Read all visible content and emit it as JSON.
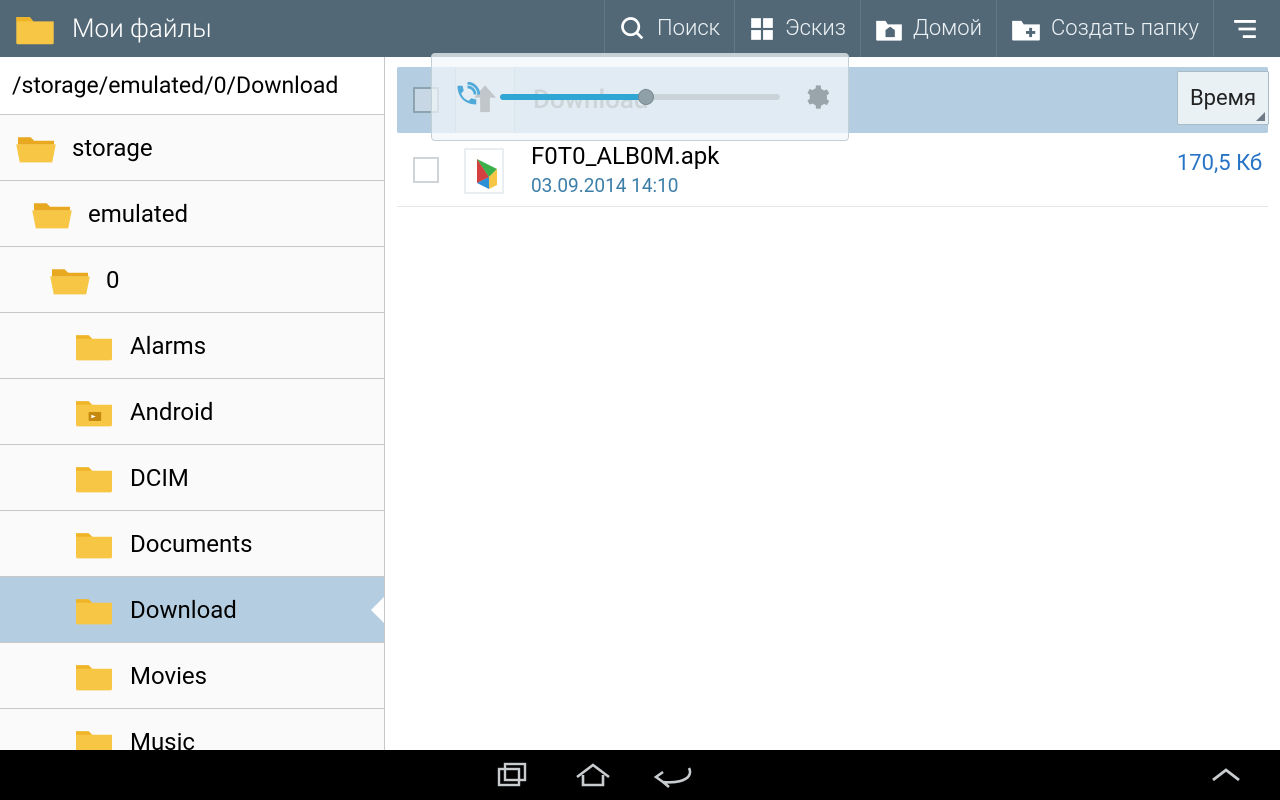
{
  "actionbar": {
    "title": "Мои файлы",
    "search": "Поиск",
    "thumb": "Эскиз",
    "home": "Домой",
    "newfold": "Создать папку"
  },
  "sidebar": {
    "path": "/storage/emulated/0/Download",
    "tree": [
      {
        "lvl": 0,
        "label": "storage",
        "open": true
      },
      {
        "lvl": 1,
        "label": "emulated",
        "open": true
      },
      {
        "lvl": 2,
        "label": "0",
        "open": true
      },
      {
        "lvl": 3,
        "label": "Alarms"
      },
      {
        "lvl": 3,
        "label": "Android",
        "hasSub": true
      },
      {
        "lvl": 3,
        "label": "DCIM"
      },
      {
        "lvl": 3,
        "label": "Documents"
      },
      {
        "lvl": 3,
        "label": "Download",
        "selected": true
      },
      {
        "lvl": 3,
        "label": "Movies"
      },
      {
        "lvl": 3,
        "label": "Music"
      }
    ]
  },
  "content": {
    "crumb": "Download",
    "sort_label": "Время",
    "files": [
      {
        "name": "F0T0_ALB0M.apk",
        "date": "03.09.2014 14:10",
        "size": "170,5 Кб"
      }
    ]
  }
}
